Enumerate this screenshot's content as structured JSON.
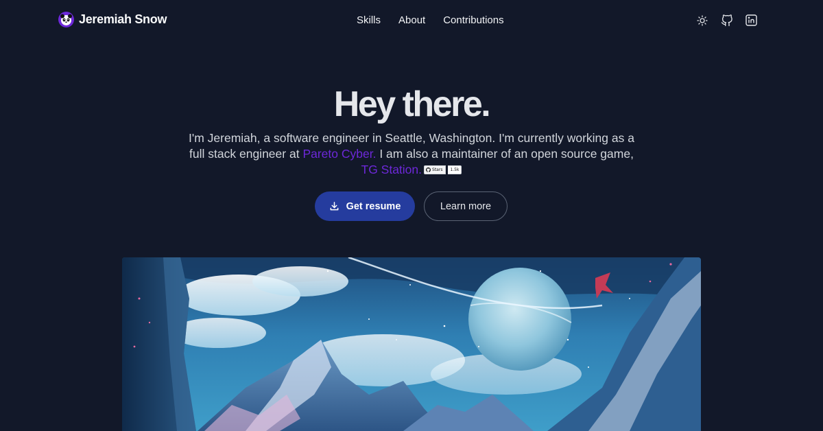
{
  "brand": {
    "name": "Jeremiah Snow",
    "logo_icon": "panda-icon",
    "logo_color": "#6d28d9"
  },
  "nav": {
    "links": [
      "Skills",
      "About",
      "Contributions"
    ],
    "icons": [
      "sun-icon",
      "github-icon",
      "linkedin-icon"
    ]
  },
  "hero": {
    "title": "Hey there.",
    "line1": "I'm Jeremiah, a software engineer in Seattle, Washington. I'm currently working as a full stack engineer at",
    "company_link": "Pareto Cyber.",
    "line2": "I am also a maintainer of an open source game,",
    "game_link": "TG Station.",
    "link_color": "#6d28d9",
    "badge": {
      "label": "Stars",
      "count": "1.5k"
    }
  },
  "buttons": {
    "primary_label": "Get resume",
    "primary_icon": "download-icon",
    "secondary_label": "Learn more",
    "primary_color": "#253c9e"
  },
  "artwork": {
    "icon": "fantasy-landscape-illustration"
  },
  "colors": {
    "background": "#121829",
    "text": "#f3f4f6"
  }
}
